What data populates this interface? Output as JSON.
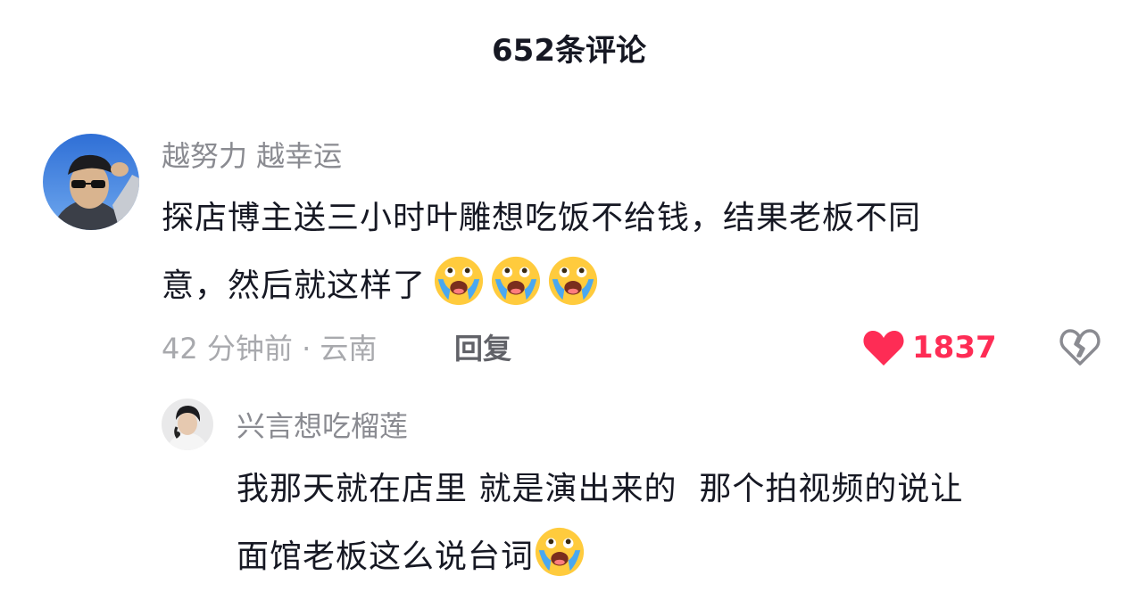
{
  "header": {
    "title": "652条评论"
  },
  "comments": [
    {
      "username": "越努力 越幸运",
      "text_line1": "探店博主送三小时叶雕想吃饭不给钱，结果老板不同",
      "text_line2": "意，然后就这样了",
      "emoji": "crying-face-icon",
      "emoji_count": 3,
      "time": "42 分钟前 · 云南",
      "reply_label": "回复",
      "likes": "1837",
      "liked": true,
      "replies": [
        {
          "username": "兴言想吃榴莲",
          "text_line1": "我那天就在店里 就是演出来的  那个拍视频的说让",
          "text_line2": "面馆老板这么说台词",
          "emoji": "crying-face-icon",
          "emoji_count": 1
        }
      ]
    }
  ],
  "colors": {
    "like_red": "#fe2c55",
    "username_gray": "#8a8b91",
    "meta_gray": "#a8a9ad",
    "text_dark": "#161823"
  }
}
